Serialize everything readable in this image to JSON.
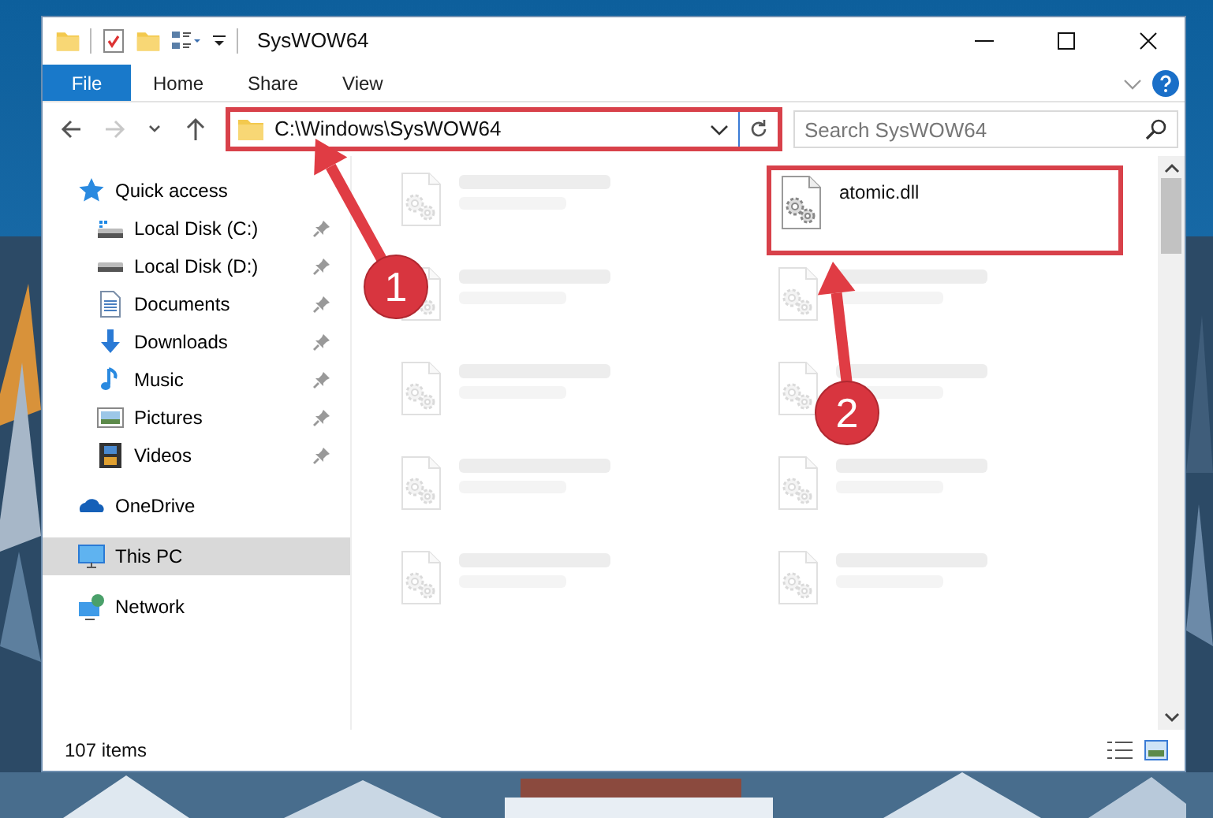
{
  "window": {
    "title": "SysWOW64"
  },
  "ribbon_tabs": [
    {
      "label": "File",
      "kind": "file"
    },
    {
      "label": "Home",
      "kind": "tab"
    },
    {
      "label": "Share",
      "kind": "tab"
    },
    {
      "label": "View",
      "kind": "tab"
    }
  ],
  "nav_buttons": [
    {
      "kind": "back",
      "disabled": false
    },
    {
      "kind": "forward",
      "disabled": true
    },
    {
      "kind": "recent",
      "disabled": false
    },
    {
      "kind": "up",
      "disabled": false
    }
  ],
  "address": {
    "value": "C:\\Windows\\SysWOW64",
    "highlighted": true
  },
  "search": {
    "placeholder": "Search SysWOW64"
  },
  "sidebar": [
    {
      "label": "Quick access",
      "kind": "quick",
      "selected": false,
      "children": [
        {
          "label": "Local Disk (C:)",
          "kind": "drive-c",
          "pinned": true,
          "selected": false
        },
        {
          "label": "Local Disk (D:)",
          "kind": "drive",
          "pinned": true,
          "selected": false
        },
        {
          "label": "Documents",
          "kind": "documents",
          "pinned": true,
          "selected": false
        },
        {
          "label": "Downloads",
          "kind": "downloads",
          "pinned": true,
          "selected": false
        },
        {
          "label": "Music",
          "kind": "music",
          "pinned": true,
          "selected": false
        },
        {
          "label": "Pictures",
          "kind": "pictures",
          "pinned": true,
          "selected": false
        },
        {
          "label": "Videos",
          "kind": "videos",
          "pinned": true,
          "selected": false
        }
      ]
    },
    {
      "label": "OneDrive",
      "kind": "onedrive",
      "selected": false
    },
    {
      "label": "This PC",
      "kind": "pc",
      "selected": true
    },
    {
      "label": "Network",
      "kind": "network",
      "selected": false
    }
  ],
  "files": [
    {
      "blurred": true
    },
    {
      "name": "atomic.dll",
      "blurred": false,
      "highlighted": true
    },
    {
      "blurred": true
    },
    {
      "blurred": true
    },
    {
      "blurred": true
    },
    {
      "blurred": true
    },
    {
      "blurred": true
    },
    {
      "blurred": true
    },
    {
      "blurred": true
    },
    {
      "blurred": true
    }
  ],
  "status_bar": {
    "item_count": "107 items"
  },
  "annotations": [
    {
      "number": "1"
    },
    {
      "number": "2"
    }
  ]
}
